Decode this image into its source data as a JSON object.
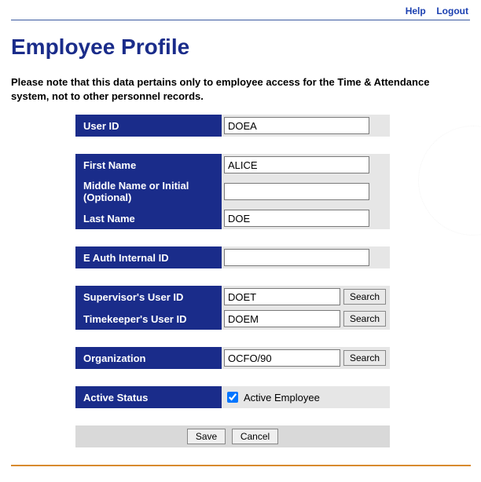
{
  "topLinks": {
    "help": "Help",
    "logout": "Logout"
  },
  "title": "Employee Profile",
  "note": "Please note that this data pertains only to employee access for the Time & Attendance system, not to other personnel records.",
  "fields": {
    "userId": {
      "label": "User ID",
      "value": "DOEA"
    },
    "firstName": {
      "label": "First Name",
      "value": "ALICE"
    },
    "middleName": {
      "label": "Middle Name or Initial (Optional)",
      "value": ""
    },
    "lastName": {
      "label": "Last Name",
      "value": "DOE"
    },
    "eAuth": {
      "label": "E Auth Internal ID",
      "value": ""
    },
    "supervisor": {
      "label": "Supervisor's User ID",
      "value": "DOET",
      "button": "Search"
    },
    "timekeeper": {
      "label": "Timekeeper's User ID",
      "value": "DOEM",
      "button": "Search"
    },
    "organization": {
      "label": "Organization",
      "value": "OCFO/90",
      "button": "Search"
    },
    "activeStatus": {
      "label": "Active Status",
      "checkboxLabel": "Active Employee",
      "checked": true
    }
  },
  "actions": {
    "save": "Save",
    "cancel": "Cancel"
  }
}
